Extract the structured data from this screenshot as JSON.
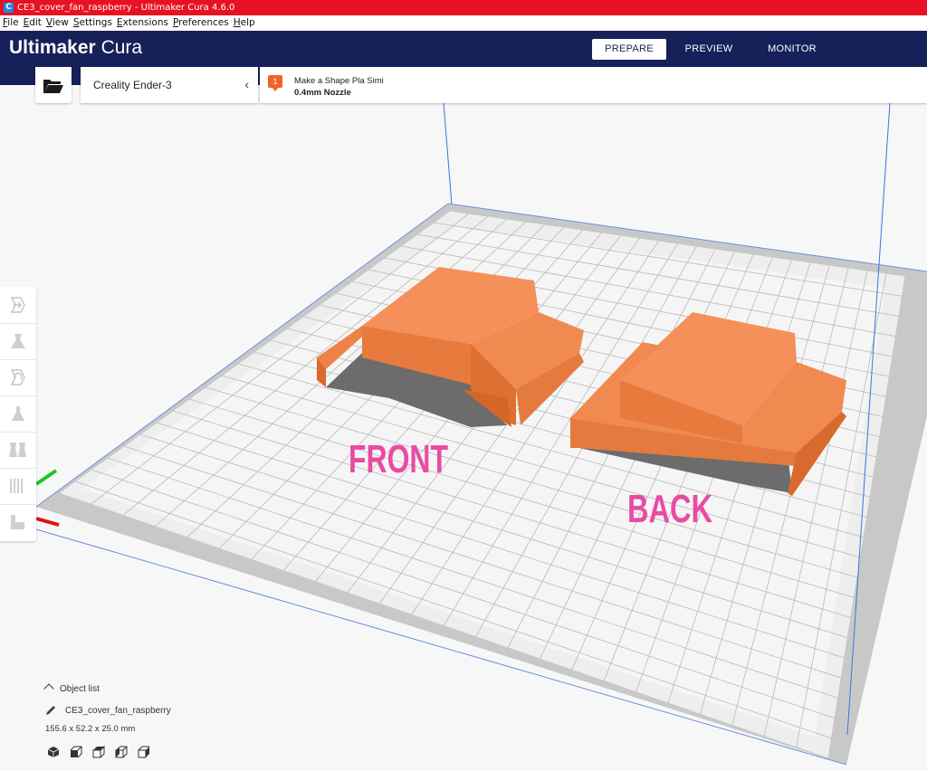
{
  "window": {
    "title": "CE3_cover_fan_raspberry - Ultimaker Cura 4.6.0",
    "app_icon_letter": "C"
  },
  "menu": [
    "File",
    "Edit",
    "View",
    "Settings",
    "Extensions",
    "Preferences",
    "Help"
  ],
  "header": {
    "brand_bold": "Ultimaker",
    "brand_light": "Cura",
    "tabs": [
      {
        "label": "PREPARE",
        "active": true
      },
      {
        "label": "PREVIEW",
        "active": false
      },
      {
        "label": "MONITOR",
        "active": false
      }
    ],
    "bg_color": "#162059"
  },
  "printer": {
    "name": "Creality Ender-3",
    "chevron": "‹"
  },
  "material": {
    "badge": "1",
    "name": "Make a Shape Pla Simi",
    "nozzle": "0.4mm Nozzle",
    "badge_color": "#f06326"
  },
  "scene": {
    "labels": {
      "front": "FRONT",
      "back": "BACK"
    },
    "label_color": "#e94ba3",
    "model_color": "#f28a4a"
  },
  "left_tools": [
    "move-tool-icon",
    "scale-tool-icon",
    "rotate-tool-icon",
    "mirror-tool-icon",
    "per-model-settings-icon",
    "support-blocker-icon",
    "layflat-icon"
  ],
  "object_list": {
    "toggle_label": "Object list",
    "object_name": "CE3_cover_fan_raspberry",
    "dimensions": "155.6 x 52.2 x 25.0 mm",
    "view_buttons": [
      "view-3d-icon",
      "view-front-icon",
      "view-top-icon",
      "view-left-icon",
      "view-right-icon"
    ]
  }
}
